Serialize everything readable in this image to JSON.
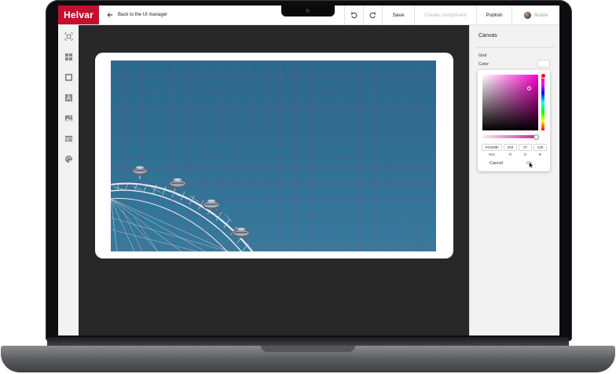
{
  "app": {
    "logo_text": "Helvar",
    "back_link": "Back to the UI manager"
  },
  "toolbar": {
    "save_label": "Save",
    "create_component_label": "Create component",
    "publish_label": "Publish",
    "user_name": "Andre"
  },
  "left_tools": [
    {
      "name": "select-tool",
      "icon": "crosshair-select-icon"
    },
    {
      "name": "layout-tool",
      "icon": "layout-grid-icon"
    },
    {
      "name": "shape-tool",
      "icon": "square-shape-icon"
    },
    {
      "name": "text-tool",
      "icon": "text-a-icon"
    },
    {
      "name": "image-tool",
      "icon": "image-icon"
    },
    {
      "name": "table-tool",
      "icon": "table-icon"
    },
    {
      "name": "palette-tool",
      "icon": "palette-icon"
    }
  ],
  "panel": {
    "title": "Canvas",
    "grid_label": "Grid",
    "color_label": "Color"
  },
  "color_picker": {
    "hex": "#cb258b",
    "r": "203",
    "g": "37",
    "b": "139",
    "hex_label": "Hex",
    "r_label": "R",
    "g_label": "G",
    "b_label": "B",
    "cancel_label": "Cancel",
    "ok_label": "Ok",
    "hue_color": "#ff00cc",
    "selected_color": "#cb258b"
  },
  "colors": {
    "brand": "#c4102e",
    "canvas_bg": "#282828",
    "sky": "#2f6f92"
  }
}
